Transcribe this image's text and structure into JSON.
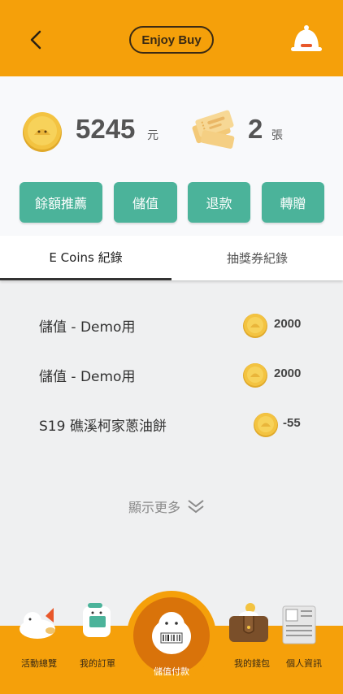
{
  "header": {
    "title": "Enjoy Buy",
    "back_icon": "chevron-left-icon",
    "bell_icon": "bell-icon",
    "color": "#f5a00a"
  },
  "summary": {
    "coin_balance": "5245",
    "coin_unit": "元",
    "ticket_count": "2",
    "ticket_unit": "張"
  },
  "actions": [
    {
      "label": "餘額推薦"
    },
    {
      "label": "儲值"
    },
    {
      "label": "退款"
    },
    {
      "label": "轉贈"
    }
  ],
  "tabs": [
    {
      "label": "E Coins 紀錄",
      "active": true
    },
    {
      "label": "抽獎券紀錄",
      "active": false
    }
  ],
  "records": [
    {
      "label": "儲值 - Demo用",
      "amount": "2000"
    },
    {
      "label": "儲值 - Demo用",
      "amount": "2000"
    },
    {
      "label": "S19 礁溪柯家蔥油餅",
      "amount": "-55"
    }
  ],
  "show_more": "顯示更多",
  "bottom_nav": {
    "items": [
      {
        "label": "活動總覽",
        "icon": "bird-icon"
      },
      {
        "label": "我的訂單",
        "icon": "order-icon"
      },
      {
        "label": "儲值付款",
        "icon": "barcode-mascot-icon"
      },
      {
        "label": "我的錢包",
        "icon": "wallet-icon"
      },
      {
        "label": "個人資訊",
        "icon": "newspaper-icon"
      }
    ]
  },
  "colors": {
    "accent": "#f5a00a",
    "button": "#4bb39a",
    "coin": "#f3c341"
  }
}
